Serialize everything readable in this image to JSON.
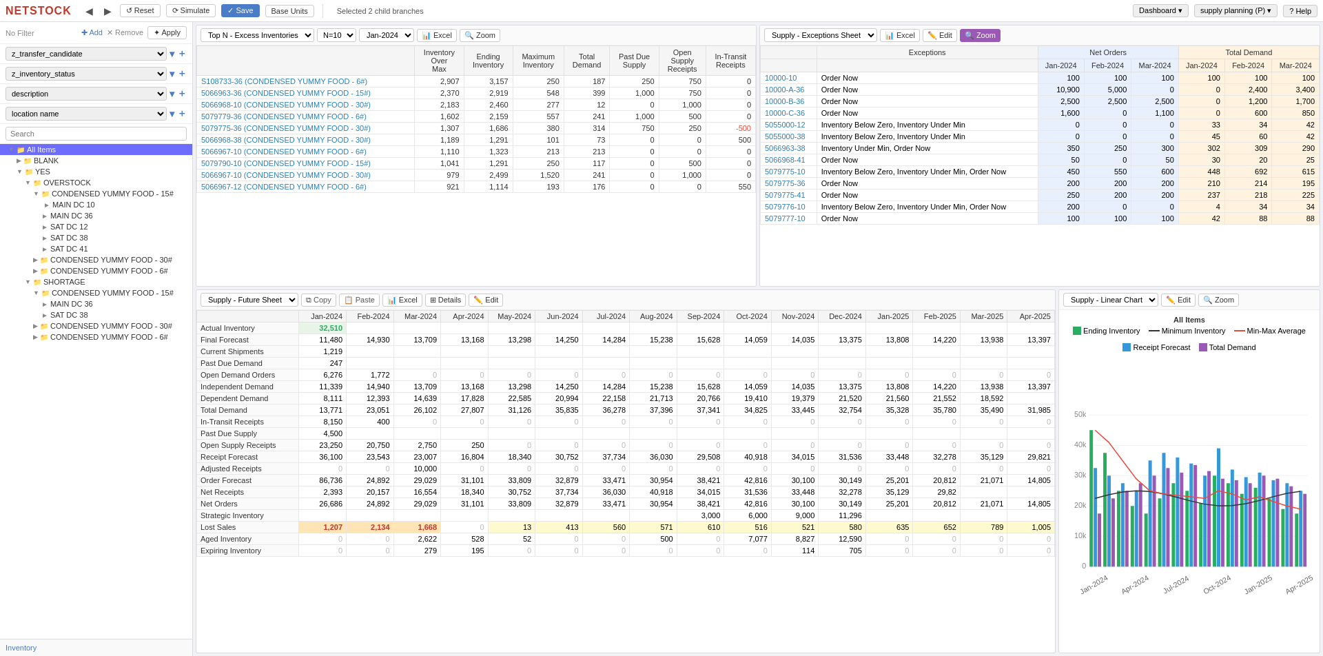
{
  "toolbar": {
    "back_label": "◀",
    "forward_label": "▶",
    "reset_label": "↺ Reset",
    "simulate_label": "⟳ Simulate",
    "save_label": "✓ Save",
    "base_units_label": "Base Units",
    "selected_info": "Selected 2 child branches",
    "dashboard_label": "Dashboard ▾",
    "supply_planning_label": "supply planning (P) ▾",
    "help_label": "? Help"
  },
  "sidebar": {
    "no_filter_label": "No Filter",
    "add_label": "✚ Add",
    "remove_label": "✕ Remove",
    "apply_label": "✦ Apply",
    "filters": [
      {
        "name": "z_transfer_candidate"
      },
      {
        "name": "z_inventory_status"
      },
      {
        "name": "description"
      },
      {
        "name": "location name"
      }
    ],
    "search_placeholder": "Search",
    "tree": [
      {
        "label": "All Items",
        "level": 0,
        "selected": true,
        "type": "folder"
      },
      {
        "label": "BLANK",
        "level": 1,
        "type": "folder"
      },
      {
        "label": "YES",
        "level": 1,
        "type": "folder",
        "expanded": true
      },
      {
        "label": "OVERSTOCK",
        "level": 2,
        "type": "folder",
        "expanded": true
      },
      {
        "label": "CONDENSED YUMMY FOOD - 15#",
        "level": 3,
        "type": "folder",
        "expanded": true
      },
      {
        "label": "MAIN DC 10",
        "level": 4,
        "type": "item"
      },
      {
        "label": "MAIN DC 36",
        "level": 4,
        "type": "item"
      },
      {
        "label": "SAT DC 12",
        "level": 4,
        "type": "item"
      },
      {
        "label": "SAT DC 38",
        "level": 4,
        "type": "item"
      },
      {
        "label": "DC 41",
        "level": 4,
        "type": "item"
      },
      {
        "label": "CONDENSED YUMMY FOOD - 30#",
        "level": 3,
        "type": "folder",
        "expanded": false
      },
      {
        "label": "CONDENSED YUMMY FOOD - 6#",
        "level": 3,
        "type": "folder",
        "expanded": false
      },
      {
        "label": "SHORTAGE",
        "level": 2,
        "type": "folder",
        "expanded": true
      },
      {
        "label": "CONDENSED YUMMY FOOD - 15#",
        "level": 3,
        "type": "folder",
        "expanded": true
      },
      {
        "label": "MAIN DC 36",
        "level": 4,
        "type": "item"
      },
      {
        "label": "SAT DC 38",
        "level": 4,
        "type": "item"
      },
      {
        "label": "CONDENSED YUMMY FOOD - 30#",
        "level": 3,
        "type": "folder",
        "expanded": false
      },
      {
        "label": "CONDENSED YUMMY FOOD - 6#",
        "level": 3,
        "type": "folder",
        "expanded": false
      }
    ]
  },
  "top_excess": {
    "title": "Top N - Excess Inventories",
    "n_value": "N=10",
    "date_value": "Jan-2024",
    "excel_label": "Excel",
    "zoom_label": "Zoom",
    "headers": {
      "col1": "Inventory Over Max",
      "col2": "Ending Inventory",
      "col3": "Maximum Inventory",
      "col4": "Total Demand",
      "col5": "Past Due Supply",
      "col6": "Open Supply Receipts",
      "col7": "In-Transit Receipts"
    },
    "rows": [
      {
        "id": "S108733-36 (CONDENSED YUMMY FOOD - 6#)",
        "v1": "2,907",
        "v2": "3,157",
        "v3": "250",
        "v4": "187",
        "v5": "250",
        "v6": "750",
        "v7": "0"
      },
      {
        "id": "5066963-36 (CONDENSED YUMMY FOOD - 15#)",
        "v1": "2,370",
        "v2": "2,919",
        "v3": "548",
        "v4": "399",
        "v5": "1,000",
        "v6": "750",
        "v7": "0"
      },
      {
        "id": "5066968-10 (CONDENSED YUMMY FOOD - 30#)",
        "v1": "2,183",
        "v2": "2,460",
        "v3": "277",
        "v4": "12",
        "v5": "0",
        "v6": "1,000",
        "v7": "0"
      },
      {
        "id": "5079779-36 (CONDENSED YUMMY FOOD - 6#)",
        "v1": "1,602",
        "v2": "2,159",
        "v3": "557",
        "v4": "241",
        "v5": "1,000",
        "v6": "500",
        "v7": "0"
      },
      {
        "id": "5079775-36 (CONDENSED YUMMY FOOD - 30#)",
        "v1": "1,307",
        "v2": "1,686",
        "v3": "380",
        "v4": "314",
        "v5": "750",
        "v6": "250",
        "v7": "-500"
      },
      {
        "id": "5066968-38 (CONDENSED YUMMY FOOD - 30#)",
        "v1": "1,189",
        "v2": "1,291",
        "v3": "101",
        "v4": "73",
        "v5": "0",
        "v6": "0",
        "v7": "500"
      },
      {
        "id": "5066967-10 (CONDENSED YUMMY FOOD - 6#)",
        "v1": "1,110",
        "v2": "1,323",
        "v3": "213",
        "v4": "213",
        "v5": "0",
        "v6": "0",
        "v7": "0"
      },
      {
        "id": "5079790-10 (CONDENSED YUMMY FOOD - 15#)",
        "v1": "1,041",
        "v2": "1,291",
        "v3": "250",
        "v4": "117",
        "v5": "0",
        "v6": "500",
        "v7": "0"
      },
      {
        "id": "5066967-10 (CONDENSED YUMMY FOOD - 30#)",
        "v1": "979",
        "v2": "2,499",
        "v3": "1,520",
        "v4": "241",
        "v5": "0",
        "v6": "1,000",
        "v7": "0"
      },
      {
        "id": "5066967-12 (CONDENSED YUMMY FOOD - 6#)",
        "v1": "921",
        "v2": "1,114",
        "v3": "193",
        "v4": "176",
        "v5": "0",
        "v6": "0",
        "v7": "550"
      }
    ]
  },
  "exceptions": {
    "title": "Supply - Exceptions Sheet",
    "excel_label": "Excel",
    "edit_label": "Edit",
    "zoom_label": "Zoom",
    "header_net_orders": "Net Orders",
    "header_total_demand": "Total Demand",
    "col_jan24": "Jan-2024",
    "col_feb24": "Feb-2024",
    "col_mar24": "Mar-2024",
    "col_jan24b": "Jan-2024",
    "col_feb24b": "Feb-2024",
    "col_mar24b": "Mar-2024",
    "rows": [
      {
        "id": "10000-10",
        "exc": "Order Now",
        "n1": "100",
        "n2": "100",
        "n3": "100",
        "d1": "100",
        "d2": "100",
        "d3": "100"
      },
      {
        "id": "10000-A-36",
        "exc": "Order Now",
        "n1": "10,900",
        "n2": "5,000",
        "n3": "0",
        "d1": "0",
        "d2": "2,400",
        "d3": "3,400"
      },
      {
        "id": "10000-B-36",
        "exc": "Order Now",
        "n1": "2,500",
        "n2": "2,500",
        "n3": "2,500",
        "d1": "0",
        "d2": "1,200",
        "d3": "1,700"
      },
      {
        "id": "10000-C-36",
        "exc": "Order Now",
        "n1": "1,600",
        "n2": "0",
        "n3": "1,100",
        "d1": "0",
        "d2": "600",
        "d3": "850"
      },
      {
        "id": "5055000-12",
        "exc": "Inventory Below Zero, Inventory Under Min",
        "n1": "0",
        "n2": "0",
        "n3": "0",
        "d1": "33",
        "d2": "34",
        "d3": "42"
      },
      {
        "id": "5055000-38",
        "exc": "Inventory Below Zero, Inventory Under Min",
        "n1": "0",
        "n2": "0",
        "n3": "0",
        "d1": "45",
        "d2": "60",
        "d3": "42"
      },
      {
        "id": "5066963-38",
        "exc": "Inventory Under Min, Order Now",
        "n1": "350",
        "n2": "250",
        "n3": "300",
        "d1": "302",
        "d2": "309",
        "d3": "290"
      },
      {
        "id": "5066968-41",
        "exc": "Order Now",
        "n1": "50",
        "n2": "0",
        "n3": "50",
        "d1": "30",
        "d2": "20",
        "d3": "25"
      },
      {
        "id": "5079775-10",
        "exc": "Inventory Below Zero, Inventory Under Min, Order Now",
        "n1": "450",
        "n2": "550",
        "n3": "600",
        "d1": "448",
        "d2": "692",
        "d3": "615"
      },
      {
        "id": "5079775-36",
        "exc": "Order Now",
        "n1": "200",
        "n2": "200",
        "n3": "200",
        "d1": "210",
        "d2": "214",
        "d3": "195"
      },
      {
        "id": "5079775-41",
        "exc": "Order Now",
        "n1": "250",
        "n2": "200",
        "n3": "200",
        "d1": "237",
        "d2": "218",
        "d3": "225"
      },
      {
        "id": "5079776-10",
        "exc": "Inventory Below Zero, Inventory Under Min, Order Now",
        "n1": "200",
        "n2": "0",
        "n3": "0",
        "d1": "4",
        "d2": "34",
        "d3": "34"
      },
      {
        "id": "5079777-10",
        "exc": "Order Now",
        "n1": "100",
        "n2": "100",
        "n3": "100",
        "d1": "42",
        "d2": "88",
        "d3": "88"
      }
    ]
  },
  "future_sheet": {
    "title": "Supply - Future Sheet",
    "copy_label": "Copy",
    "paste_label": "Paste",
    "excel_label": "Excel",
    "details_label": "Details",
    "edit_label": "Edit",
    "months": [
      "Jan-2024",
      "Feb-2024",
      "Mar-2024",
      "Apr-2024",
      "May-2024",
      "Jun-2024",
      "Jul-2024",
      "Aug-2024",
      "Sep-2024",
      "Oct-2024",
      "Nov-2024",
      "Dec-2024",
      "Jan-2025",
      "Feb-2025",
      "Mar-2025",
      "Apr-2025"
    ],
    "rows": [
      {
        "label": "Actual Inventory",
        "values": [
          "32,510",
          "",
          "",
          "",
          "",
          "",
          "",
          "",
          "",
          "",
          "",
          "",
          "",
          "",
          "",
          ""
        ],
        "style": "actual-inv"
      },
      {
        "label": "Final Forecast",
        "values": [
          "11,480",
          "14,930",
          "13,709",
          "13,168",
          "13,298",
          "14,250",
          "14,284",
          "15,238",
          "15,628",
          "14,059",
          "14,035",
          "13,375",
          "13,808",
          "14,220",
          "13,938",
          "13,397"
        ]
      },
      {
        "label": "Current Shipments",
        "values": [
          "1,219",
          "",
          "",
          "",
          "",
          "",
          "",
          "",
          "",
          "",
          "",
          "",
          "",
          "",
          "",
          ""
        ]
      },
      {
        "label": "Past Due Demand",
        "values": [
          "247",
          "",
          "",
          "",
          "",
          "",
          "",
          "",
          "",
          "",
          "",
          "",
          "",
          "",
          "",
          ""
        ]
      },
      {
        "label": "Open Demand Orders",
        "values": [
          "6,276",
          "1,772",
          "0",
          "0",
          "0",
          "0",
          "0",
          "0",
          "0",
          "0",
          "0",
          "0",
          "0",
          "0",
          "0",
          "0"
        ]
      },
      {
        "label": "Independent Demand",
        "values": [
          "11,339",
          "14,940",
          "13,709",
          "13,168",
          "13,298",
          "14,250",
          "14,284",
          "15,238",
          "15,628",
          "14,059",
          "14,035",
          "13,375",
          "13,808",
          "14,220",
          "13,938",
          "13,397"
        ]
      },
      {
        "label": "Dependent Demand",
        "values": [
          "8,111",
          "12,393",
          "14,639",
          "17,828",
          "22,585",
          "20,994",
          "22,158",
          "21,713",
          "20,766",
          "19,410",
          "19,379",
          "21,520",
          "21,560",
          "21,552",
          "18,592",
          ""
        ]
      },
      {
        "label": "Total Demand",
        "values": [
          "13,771",
          "23,051",
          "26,102",
          "27,807",
          "31,126",
          "35,835",
          "36,278",
          "37,396",
          "37,341",
          "34,825",
          "33,445",
          "32,754",
          "35,328",
          "35,780",
          "35,490",
          "31,985"
        ]
      },
      {
        "label": "In-Transit Receipts",
        "values": [
          "8,150",
          "400",
          "0",
          "0",
          "0",
          "0",
          "0",
          "0",
          "0",
          "0",
          "0",
          "0",
          "0",
          "0",
          "0",
          "0"
        ]
      },
      {
        "label": "Past Due Supply",
        "values": [
          "4,500",
          "",
          "",
          "",
          "",
          "",
          "",
          "",
          "",
          "",
          "",
          "",
          "",
          "",
          "",
          ""
        ]
      },
      {
        "label": "Open Supply Receipts",
        "values": [
          "23,250",
          "20,750",
          "2,750",
          "250",
          "0",
          "0",
          "0",
          "0",
          "0",
          "0",
          "0",
          "0",
          "0",
          "0",
          "0",
          "0"
        ]
      },
      {
        "label": "Receipt Forecast",
        "values": [
          "36,100",
          "23,543",
          "23,007",
          "16,804",
          "18,340",
          "30,752",
          "37,734",
          "36,030",
          "29,508",
          "40,918",
          "34,015",
          "31,536",
          "33,448",
          "32,278",
          "35,129",
          "29,821"
        ]
      },
      {
        "label": "Adjusted Receipts",
        "values": [
          "0",
          "0",
          "10,000",
          "0",
          "0",
          "0",
          "0",
          "0",
          "0",
          "0",
          "0",
          "0",
          "0",
          "0",
          "0",
          "0"
        ]
      },
      {
        "label": "Order Forecast",
        "values": [
          "86,736",
          "24,892",
          "29,029",
          "31,101",
          "33,809",
          "32,879",
          "33,471",
          "30,954",
          "38,421",
          "42,816",
          "30,100",
          "30,149",
          "25,201",
          "20,812",
          "21,071",
          "14,805"
        ]
      },
      {
        "label": "Net Receipts",
        "values": [
          "2,393",
          "20,157",
          "16,554",
          "18,340",
          "30,752",
          "37,734",
          "36,030",
          "40,918",
          "34,015",
          "31,536",
          "33,448",
          "32,278",
          "35,129",
          "29,82",
          "",
          ""
        ]
      },
      {
        "label": "Net Orders",
        "values": [
          "26,686",
          "24,892",
          "29,029",
          "31,101",
          "33,809",
          "32,879",
          "33,471",
          "30,954",
          "38,421",
          "42,816",
          "30,100",
          "30,149",
          "25,201",
          "20,812",
          "21,071",
          "14,805"
        ]
      },
      {
        "label": "Strategic Inventory",
        "values": [
          "",
          "",
          "",
          "",
          "",
          "",
          "",
          "",
          "3,000",
          "6,000",
          "9,000",
          "11,296",
          "",
          "",
          "",
          ""
        ]
      },
      {
        "label": "Lost Sales",
        "values": [
          "1,207",
          "2,134",
          "1,668",
          "0",
          "13",
          "413",
          "560",
          "571",
          "610",
          "516",
          "521",
          "580",
          "635",
          "652",
          "789",
          "1,005"
        ],
        "style": "highlight-yellow"
      },
      {
        "label": "Aged Inventory",
        "values": [
          "0",
          "0",
          "2,622",
          "528",
          "52",
          "0",
          "0",
          "500",
          "0",
          "7,077",
          "8,827",
          "12,590",
          "0",
          "0",
          "0",
          "0"
        ]
      },
      {
        "label": "Expiring Inventory",
        "values": [
          "0",
          "0",
          "279",
          "195",
          "0",
          "0",
          "0",
          "0",
          "0",
          "0",
          "114",
          "705",
          "0",
          "0",
          "0",
          "0"
        ]
      }
    ]
  },
  "linear_chart": {
    "title": "Supply - Linear Chart",
    "edit_label": "Edit",
    "zoom_label": "Zoom",
    "all_items_label": "All Items",
    "legend": [
      {
        "label": "Ending Inventory",
        "color": "#27ae60",
        "type": "bar"
      },
      {
        "label": "Minimum Inventory",
        "color": "#333",
        "type": "line"
      },
      {
        "label": "Min-Max Average",
        "color": "#e74c3c",
        "type": "line"
      },
      {
        "label": "Receipt Forecast",
        "color": "#3498db",
        "type": "bar"
      },
      {
        "label": "Total Demand",
        "color": "#9b59b6",
        "type": "bar"
      }
    ],
    "y_labels": [
      "50k",
      "40k",
      "30k",
      "20k",
      "10k",
      "0"
    ],
    "x_labels": [
      "Jan-2024",
      "Apr-2024",
      "Jul-2024",
      "Oct-2024",
      "Jan-2025",
      "Apr-2025"
    ],
    "bars": [
      {
        "month": "Jan-2024",
        "ending": 90,
        "receipt": 65,
        "demand": 35
      },
      {
        "month": "Feb-2024",
        "ending": 75,
        "receipt": 60,
        "demand": 45
      },
      {
        "month": "Mar-2024",
        "ending": 50,
        "receipt": 55,
        "demand": 50
      },
      {
        "month": "Apr-2024",
        "ending": 40,
        "receipt": 50,
        "demand": 55
      },
      {
        "month": "May-2024",
        "ending": 35,
        "receipt": 70,
        "demand": 60
      },
      {
        "month": "Jun-2024",
        "ending": 45,
        "receipt": 75,
        "demand": 65
      },
      {
        "month": "Jul-2024",
        "ending": 55,
        "receipt": 72,
        "demand": 62
      },
      {
        "month": "Aug-2024",
        "ending": 50,
        "receipt": 68,
        "demand": 67
      },
      {
        "month": "Sep-2024",
        "ending": 42,
        "receipt": 60,
        "demand": 63
      },
      {
        "month": "Oct-2024",
        "ending": 60,
        "receipt": 78,
        "demand": 58
      },
      {
        "month": "Nov-2024",
        "ending": 55,
        "receipt": 64,
        "demand": 57
      },
      {
        "month": "Dec-2024",
        "ending": 48,
        "receipt": 59,
        "demand": 55
      },
      {
        "month": "Jan-2025",
        "ending": 52,
        "receipt": 62,
        "demand": 60
      },
      {
        "month": "Feb-2025",
        "ending": 45,
        "receipt": 57,
        "demand": 58
      },
      {
        "month": "Mar-2025",
        "ending": 38,
        "receipt": 55,
        "demand": 53
      },
      {
        "month": "Apr-2025",
        "ending": 35,
        "receipt": 50,
        "demand": 48
      }
    ]
  },
  "bottom_nav": {
    "inventory_label": "Inventory"
  }
}
